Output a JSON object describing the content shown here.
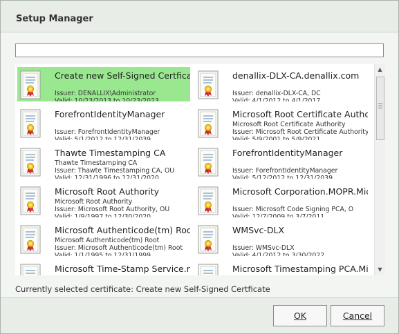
{
  "window": {
    "title": "Setup Manager"
  },
  "search": {
    "value": "",
    "placeholder": ""
  },
  "certificates": [
    {
      "title": "Create new Self-Signed Certficate",
      "lines": [
        "",
        "Issuer: DENALLIX\\Administrator",
        "Valid: 10/23/2013 to 10/23/2023"
      ],
      "selected": true
    },
    {
      "title": "denallix-DLX-CA.denallix.com",
      "lines": [
        "",
        "Issuer: denallix-DLX-CA, DC",
        "Valid: 4/1/2012 to 4/1/2017"
      ],
      "selected": false
    },
    {
      "title": "ForefrontIdentityManager",
      "lines": [
        "",
        "Issuer: ForefrontIdentityManager",
        "Valid: 5/1/2012 to 12/31/2039"
      ],
      "selected": false
    },
    {
      "title": "Microsoft Root Certificate Authority",
      "lines": [
        "Microsoft Root Certificate Authority",
        "Issuer: Microsoft Root Certificate Authority",
        "Valid: 5/9/2001 to 5/9/2021"
      ],
      "selected": false
    },
    {
      "title": "Thawte Timestamping CA",
      "lines": [
        "Thawte Timestamping CA",
        "Issuer: Thawte Timestamping CA, OU",
        "Valid: 12/31/1996 to 12/31/2020"
      ],
      "selected": false
    },
    {
      "title": "ForefrontIdentityManager",
      "lines": [
        "",
        "Issuer: ForefrontIdentityManager",
        "Valid: 5/12/2012 to 12/31/2039"
      ],
      "selected": false
    },
    {
      "title": "Microsoft Root Authority",
      "lines": [
        "Microsoft Root Authority",
        "Issuer: Microsoft Root Authority, OU",
        "Valid: 1/9/1997 to 12/30/2020"
      ],
      "selected": false
    },
    {
      "title": "Microsoft Corporation.MOPR.Microsoft Corporation",
      "lines": [
        "",
        "Issuer: Microsoft Code Signing PCA, O",
        "Valid: 12/7/2009 to 3/7/2011"
      ],
      "selected": false
    },
    {
      "title": "Microsoft Authenticode(tm) Root Authority",
      "lines": [
        "Microsoft Authenticode(tm) Root",
        "Issuer: Microsoft Authenticode(tm) Root",
        "Valid: 1/1/1995 to 12/31/1999"
      ],
      "selected": false
    },
    {
      "title": "WMSvc-DLX",
      "lines": [
        "",
        "Issuer: WMSvc-DLX",
        "Valid: 4/1/2012 to 3/30/2022"
      ],
      "selected": false
    },
    {
      "title": "Microsoft Time-Stamp Service.microsoft.com",
      "lines": [
        "",
        "",
        ""
      ],
      "selected": false
    },
    {
      "title": "Microsoft Timestamping PCA.Microsoft",
      "lines": [
        "",
        "",
        ""
      ],
      "selected": false
    }
  ],
  "status": {
    "text": "Currently selected certificate: Create new Self-Signed Certficate"
  },
  "buttons": {
    "ok": "OK",
    "cancel": "Cancel"
  },
  "colors": {
    "selected": "#99e88f",
    "titlebar": "#e8ede8",
    "background": "#f2f5f2"
  },
  "icons": {
    "certificate": "certificate-icon",
    "scroll_up": "scroll-up-arrow-icon",
    "scroll_down": "scroll-down-arrow-icon"
  }
}
